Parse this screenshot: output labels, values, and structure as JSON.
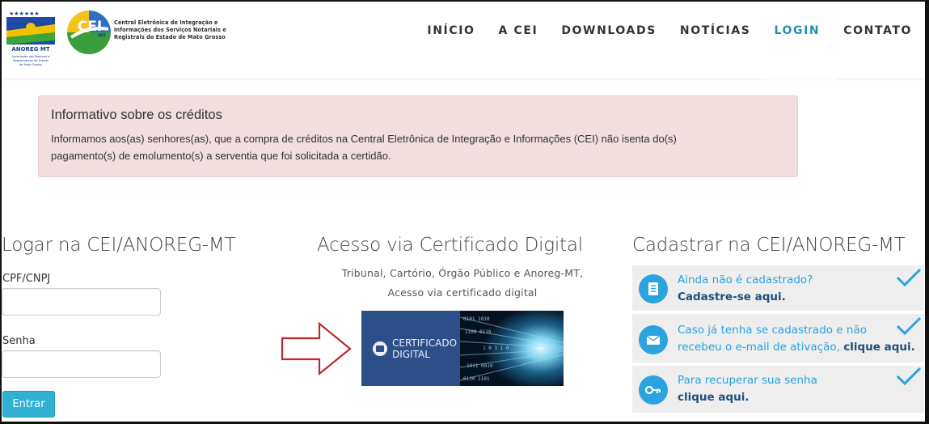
{
  "header": {
    "anoreg_logo_text": "ANOREG MT",
    "anoreg_caption": "Associação dos Notários e Registradores do Estado de Mato Grosso",
    "cei_logo_text": "CEI",
    "cei_logo_sub": "MT",
    "cei_title_lines": [
      "Central Eletrônica de Integração e",
      "Informações dos Serviços Notariais e",
      "Registrais do Estado de Mato Grosso"
    ]
  },
  "nav": {
    "items": [
      {
        "label": "INÍCIO"
      },
      {
        "label": "A CEI"
      },
      {
        "label": "DOWNLOADS"
      },
      {
        "label": "NOTÍCIAS"
      },
      {
        "label": "LOGIN"
      },
      {
        "label": "CONTATO"
      }
    ],
    "active": "LOGIN",
    "active_color": "#2b8db8"
  },
  "alert": {
    "title": "Informativo sobre os créditos",
    "body_line1": "Informamos aos(as) senhores(as), que a compra de créditos na Central Eletrônica de Integração e Informações (CEI) não isenta do(s)",
    "body_line2": "pagamento(s) de emolumento(s) a serventia que foi solicitada a certidão.",
    "background": "#f2dede"
  },
  "login": {
    "title": "Logar na CEI/ANOREG-MT",
    "cpf_label": "CPF/CNPJ",
    "cpf_value": "",
    "password_label": "Senha",
    "password_value": "",
    "submit_label": "Entrar"
  },
  "certificate": {
    "title": "Acesso via Certificado Digital",
    "subtitle_line1": "Tribunal, Cartório, Órgão Público e Anoreg-MT,",
    "subtitle_line2": "Acesso via certificado digital",
    "banner_line1": "CERTIFICADO",
    "banner_line2": "DIGITAL"
  },
  "register": {
    "title": "Cadastrar na CEI/ANOREG-MT",
    "items": [
      {
        "line1": "Ainda não é cadastrado?",
        "line2_link": "Cadastre-se aqui.",
        "icon": "form-icon"
      },
      {
        "line1": "Caso já tenha se cadastrado e não",
        "line2_text": "recebeu o e-mail de ativação, ",
        "line2_link": "clique aqui.",
        "icon": "envelope-icon"
      },
      {
        "line1": "Para recuperar sua senha",
        "line2_link": "clique aqui.",
        "icon": "key-icon"
      }
    ],
    "accent": "#2aa3de"
  }
}
